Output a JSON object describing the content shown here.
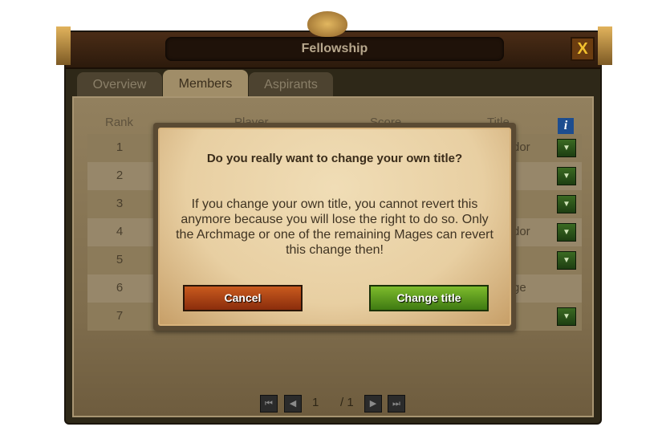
{
  "window": {
    "title": "Fellowship",
    "close_label": "X"
  },
  "tabs": [
    {
      "label": "Overview",
      "active": false
    },
    {
      "label": "Members",
      "active": true
    },
    {
      "label": "Aspirants",
      "active": false
    }
  ],
  "table": {
    "headers": [
      "Rank",
      "Player",
      "Score",
      "Title"
    ],
    "rows": [
      {
        "rank": "1",
        "title": "dor",
        "dropdown": true
      },
      {
        "rank": "2",
        "title": "",
        "dropdown": true
      },
      {
        "rank": "3",
        "title": "",
        "dropdown": true
      },
      {
        "rank": "4",
        "title": "dor",
        "dropdown": true
      },
      {
        "rank": "5",
        "title": "",
        "dropdown": true
      },
      {
        "rank": "6",
        "title": "ge",
        "dropdown": false
      },
      {
        "rank": "7",
        "title": "",
        "dropdown": true
      }
    ]
  },
  "pagination": {
    "current": "1",
    "total": "/ 1"
  },
  "dialog": {
    "question": "Do you really want to change your own title?",
    "message": "If you change your own title, you cannot revert this anymore because you will lose the right to do so. Only the Archmage or one of the remaining Mages can revert this change then!",
    "cancel_label": "Cancel",
    "confirm_label": "Change title"
  },
  "colors": {
    "cancel": "#b04a18",
    "confirm": "#5e9a1e",
    "info": "#1d4d8f"
  }
}
